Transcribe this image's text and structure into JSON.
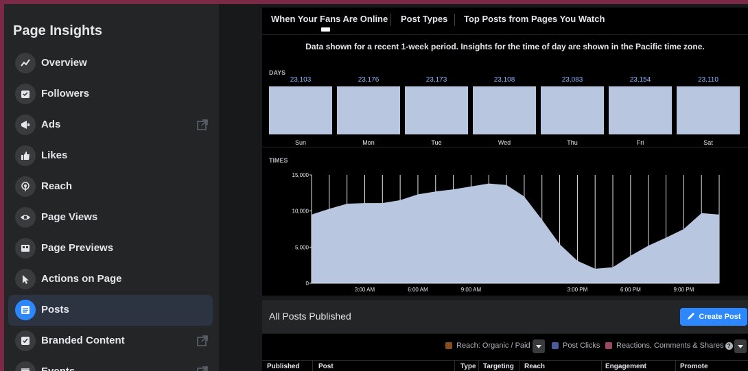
{
  "sidebar": {
    "title": "Page Insights",
    "items": [
      {
        "label": "Overview",
        "icon": "overview-icon"
      },
      {
        "label": "Followers",
        "icon": "followers-icon"
      },
      {
        "label": "Ads",
        "icon": "megaphone-icon",
        "external": true
      },
      {
        "label": "Likes",
        "icon": "thumbs-up-icon"
      },
      {
        "label": "Reach",
        "icon": "reach-icon"
      },
      {
        "label": "Page Views",
        "icon": "eye-icon"
      },
      {
        "label": "Page Previews",
        "icon": "preview-icon"
      },
      {
        "label": "Actions on Page",
        "icon": "cursor-icon"
      },
      {
        "label": "Posts",
        "icon": "posts-icon",
        "active": true
      },
      {
        "label": "Branded Content",
        "icon": "branded-content-icon",
        "external": true
      },
      {
        "label": "Events",
        "icon": "events-icon",
        "external": true
      }
    ]
  },
  "tabs": [
    {
      "label": "When Your Fans Are Online",
      "active": true
    },
    {
      "label": "Post Types"
    },
    {
      "label": "Top Posts from Pages You Watch"
    }
  ],
  "notice": "Data shown for a recent 1-week period. Insights for the time of day are shown in the Pacific time zone.",
  "days_section": {
    "label": "DAYS",
    "days": [
      {
        "name": "Sun",
        "value": "23,103"
      },
      {
        "name": "Mon",
        "value": "23,176"
      },
      {
        "name": "Tue",
        "value": "23,173"
      },
      {
        "name": "Wed",
        "value": "23,108"
      },
      {
        "name": "Thu",
        "value": "23,083"
      },
      {
        "name": "Fri",
        "value": "23,154"
      },
      {
        "name": "Sat",
        "value": "23,110"
      }
    ]
  },
  "chart_data": {
    "type": "area",
    "title": "TIMES",
    "x": [
      0,
      1,
      2,
      3,
      4,
      5,
      6,
      7,
      8,
      9,
      10,
      11,
      12,
      13,
      14,
      15,
      16,
      17,
      18,
      19,
      20,
      21,
      22,
      23
    ],
    "x_tick_labels": [
      "3:00 AM",
      "6:00 AM",
      "9:00 AM",
      "3:00 PM",
      "6:00 PM",
      "9:00 PM"
    ],
    "x_tick_positions": [
      3,
      6,
      9,
      15,
      18,
      21
    ],
    "y_ticks": [
      "0",
      "5,000",
      "10,000",
      "15,000"
    ],
    "ylim": [
      0,
      15000
    ],
    "values": [
      9500,
      10300,
      11000,
      11100,
      11100,
      11500,
      12300,
      12700,
      13000,
      13400,
      13800,
      13600,
      12000,
      8800,
      5400,
      3100,
      2000,
      2200,
      3800,
      5200,
      6300,
      7500,
      9700,
      9500
    ],
    "fill_color": "#b9c6e0"
  },
  "posts": {
    "title": "All Posts Published",
    "create_label": "Create Post",
    "legend": [
      {
        "label": "Reach: Organic / Paid",
        "color": "#8a4b1e"
      },
      {
        "label": "Post Clicks",
        "color": "#4a5a9a"
      },
      {
        "label": "Reactions, Comments & Shares",
        "color": "#9a4a60"
      }
    ],
    "columns": [
      "Published",
      "Post",
      "Type",
      "Targeting",
      "Reach",
      "Engagement",
      "Promote"
    ]
  }
}
